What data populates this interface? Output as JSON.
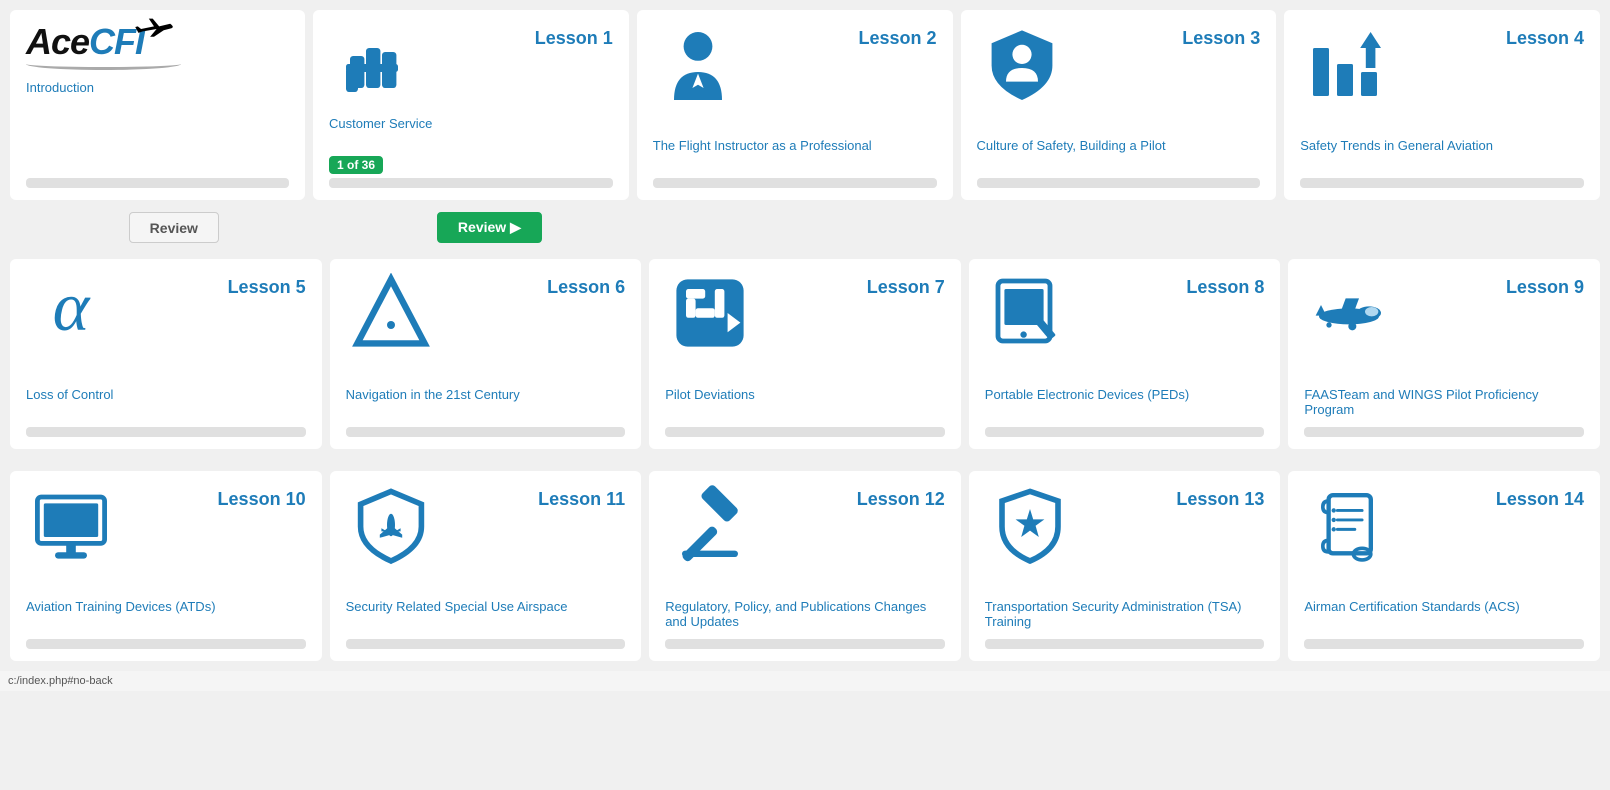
{
  "statusbar": "c:/index.php#no-back",
  "logo": {
    "ace": "Ace",
    "cfi": "CFI",
    "tagline": "Introduction"
  },
  "review_buttons": {
    "intro_review": "Review",
    "lesson1_review": "Review",
    "lesson1_badge": "1 of 36"
  },
  "lessons": [
    {
      "id": "lesson1",
      "number": "Lesson 1",
      "title": "Customer Service",
      "icon": "hand-fist",
      "has_badge": true,
      "badge_text": "1 of 36",
      "has_review": true,
      "review_active": true
    },
    {
      "id": "lesson2",
      "number": "Lesson 2",
      "title": "The Flight Instructor as a Professional",
      "icon": "person-tie",
      "has_badge": false,
      "has_review": false
    },
    {
      "id": "lesson3",
      "number": "Lesson 3",
      "title": "Culture of Safety, Building a Pilot",
      "icon": "shield-person",
      "has_badge": false,
      "has_review": false
    },
    {
      "id": "lesson4",
      "number": "Lesson 4",
      "title": "Safety Trends in General Aviation",
      "icon": "bar-chart-down",
      "has_badge": false,
      "has_review": false
    },
    {
      "id": "lesson5",
      "number": "Lesson 5",
      "title": "Loss of Control",
      "icon": "alpha",
      "has_badge": false,
      "has_review": false
    },
    {
      "id": "lesson6",
      "number": "Lesson 6",
      "title": "Navigation in the 21st Century",
      "icon": "triangle-nav",
      "has_badge": false,
      "has_review": false
    },
    {
      "id": "lesson7",
      "number": "Lesson 7",
      "title": "Pilot Deviations",
      "icon": "maze-arrow",
      "has_badge": false,
      "has_review": false
    },
    {
      "id": "lesson8",
      "number": "Lesson 8",
      "title": "Portable Electronic Devices (PEDs)",
      "icon": "tablet-pen",
      "has_badge": false,
      "has_review": false
    },
    {
      "id": "lesson9",
      "number": "Lesson 9",
      "title": "FAASTeam and WINGS Pilot Proficiency Program",
      "icon": "airplane",
      "has_badge": false,
      "has_review": false
    },
    {
      "id": "lesson10",
      "number": "Lesson 10",
      "title": "Aviation Training Devices (ATDs)",
      "icon": "monitor",
      "has_badge": false,
      "has_review": false
    },
    {
      "id": "lesson11",
      "number": "Lesson 11",
      "title": "Security Related Special Use Airspace",
      "icon": "shield-plane",
      "has_badge": false,
      "has_review": false
    },
    {
      "id": "lesson12",
      "number": "Lesson 12",
      "title": "Regulatory, Policy, and Publications Changes and Updates",
      "icon": "gavel",
      "has_badge": false,
      "has_review": false
    },
    {
      "id": "lesson13",
      "number": "Lesson 13",
      "title": "Transportation Security Administration (TSA) Training",
      "icon": "badge-star",
      "has_badge": false,
      "has_review": false
    },
    {
      "id": "lesson14",
      "number": "Lesson 14",
      "title": "Airman Certification Standards (ACS)",
      "icon": "scroll-list",
      "has_badge": false,
      "has_review": false
    }
  ]
}
